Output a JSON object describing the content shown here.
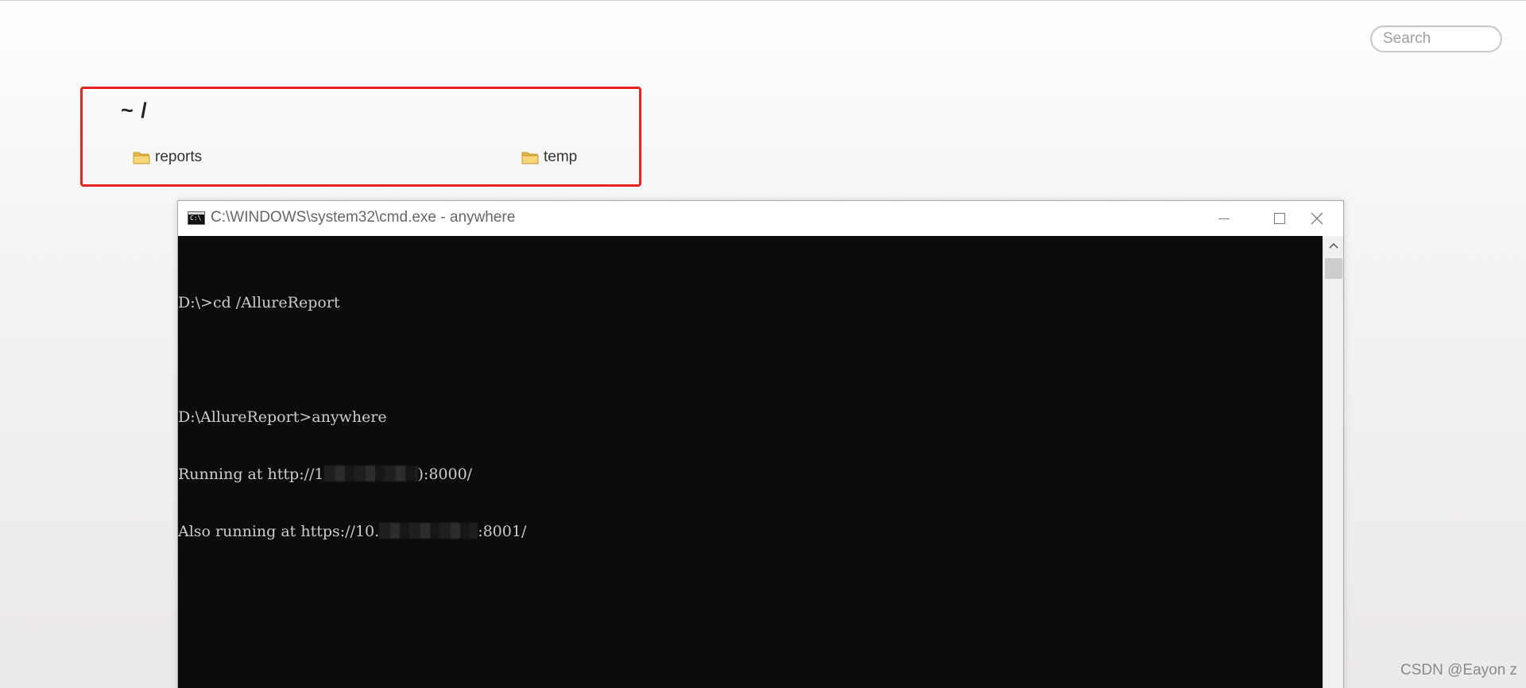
{
  "search": {
    "placeholder": "Search"
  },
  "directory": {
    "breadcrumb": "~ /",
    "items": [
      {
        "name": "reports",
        "icon": "folder-icon"
      },
      {
        "name": "temp",
        "icon": "folder-icon"
      }
    ],
    "highlight_color": "#e8231d"
  },
  "cmd_window": {
    "icon_text": "C:\\",
    "title": "C:\\WINDOWS\\system32\\cmd.exe - anywhere",
    "console_lines": {
      "l1": "D:\\>cd /AllureReport",
      "l2": "D:\\AllureReport>anywhere",
      "l3_prefix": "Running at http://1",
      "l3_suffix": "):8000/",
      "l4_prefix": "Also running at https://10.",
      "l4_suffix": ":8001/"
    }
  },
  "watermark": "CSDN @Eayon z",
  "colors": {
    "console_background": "#0c0c0c",
    "console_text": "#cccccc"
  }
}
